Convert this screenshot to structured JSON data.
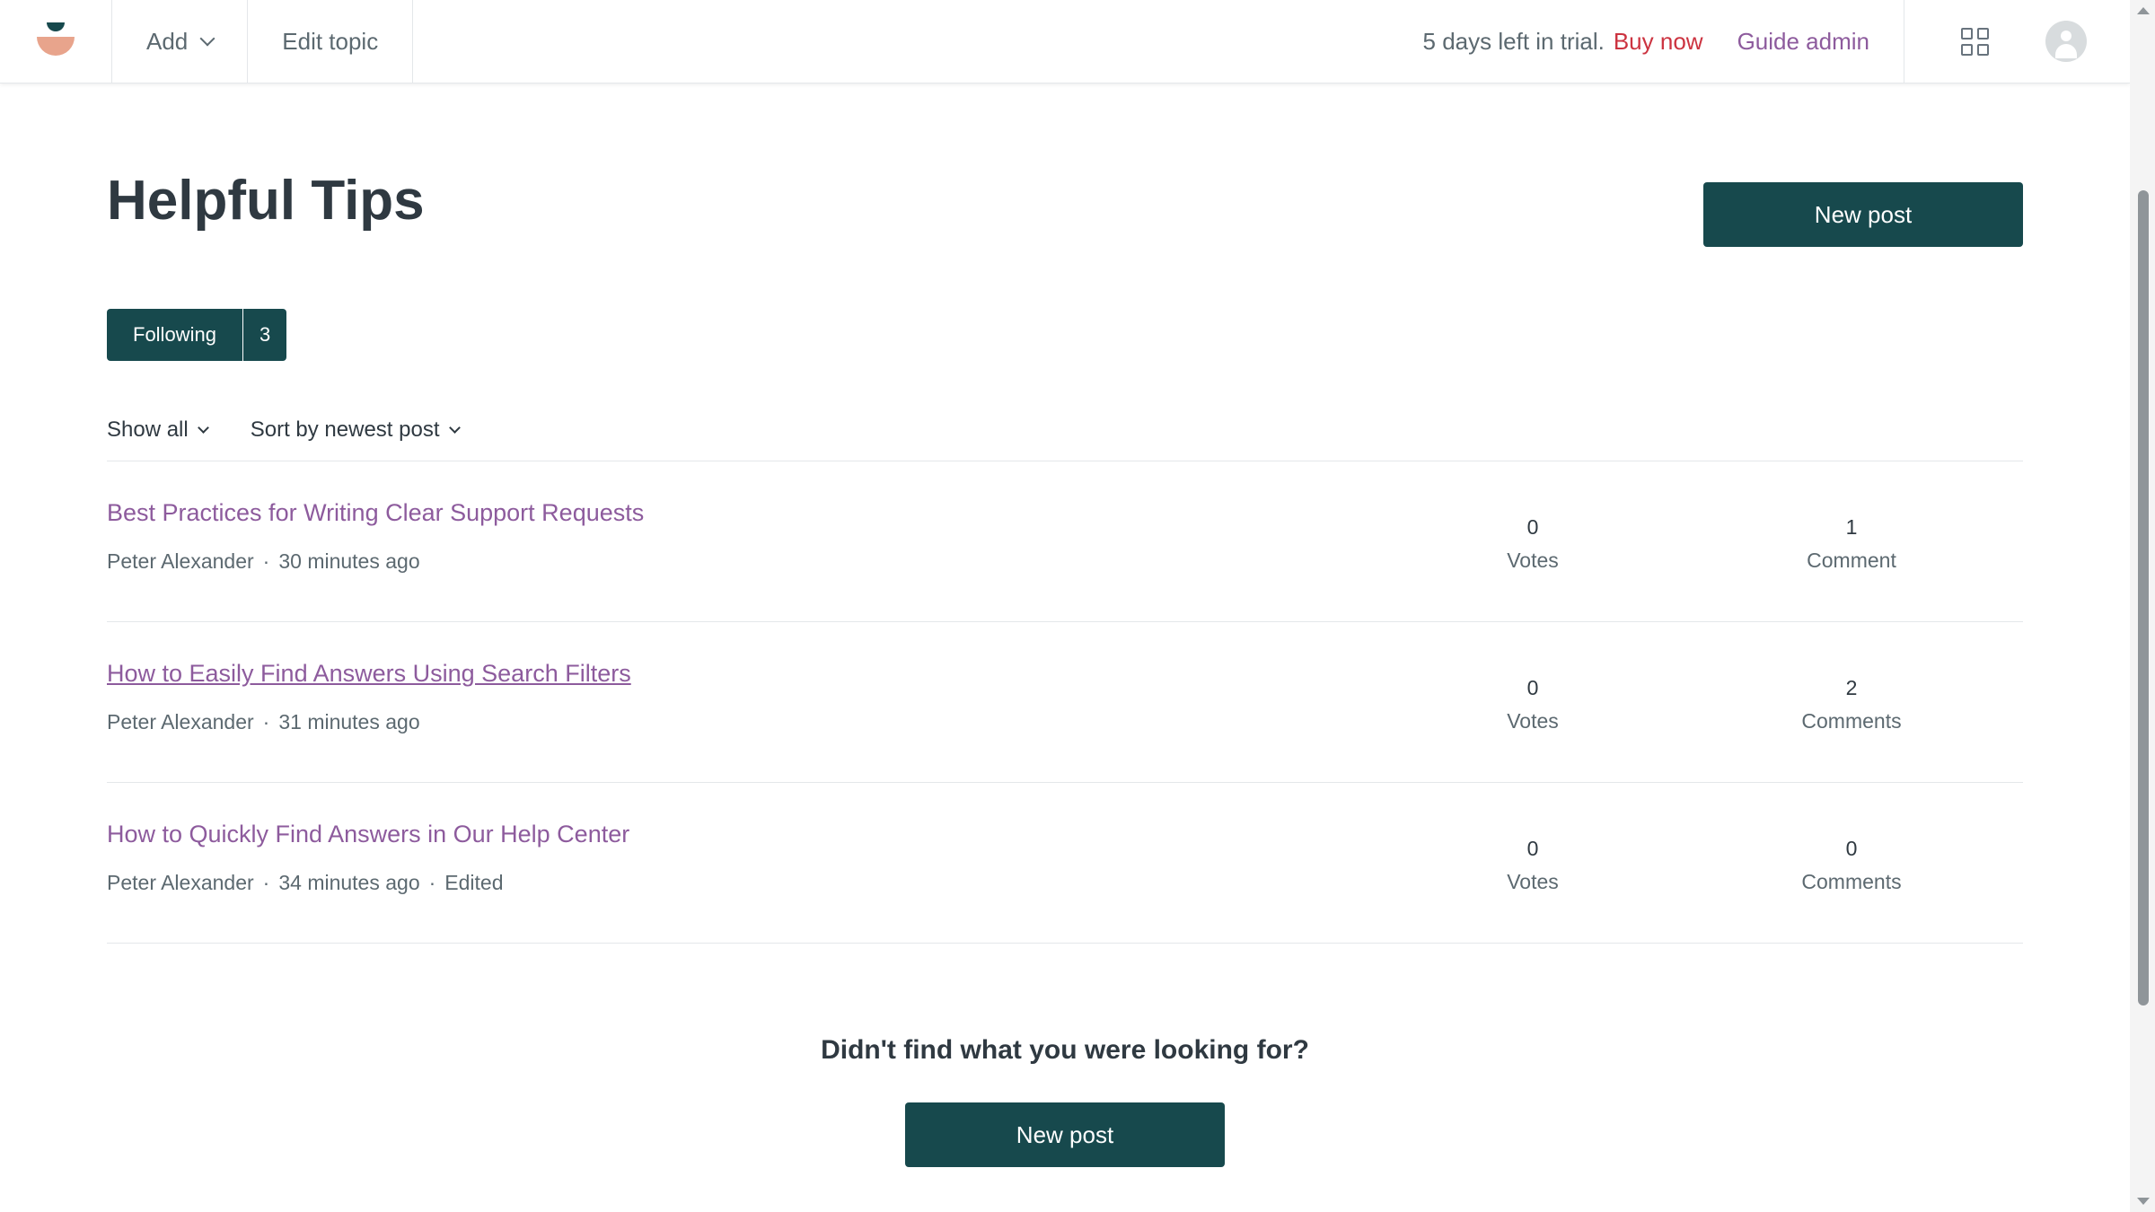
{
  "header": {
    "add_label": "Add",
    "edit_topic_label": "Edit topic",
    "trial_text": "5 days left in trial.",
    "buy_now_label": "Buy now",
    "guide_admin_label": "Guide admin"
  },
  "page": {
    "title": "Helpful Tips",
    "new_post_label": "New post",
    "following_label": "Following",
    "following_count": "3",
    "filter_show_label": "Show all",
    "filter_sort_label": "Sort by newest post"
  },
  "posts": [
    {
      "title": "Best Practices for Writing Clear Support Requests",
      "author": "Peter Alexander",
      "time": "30 minutes ago",
      "edited": "",
      "votes": "0",
      "votes_label": "Votes",
      "comments": "1",
      "comments_label": "Comment"
    },
    {
      "title": "How to Easily Find Answers Using Search Filters",
      "author": "Peter Alexander",
      "time": "31 minutes ago",
      "edited": "",
      "votes": "0",
      "votes_label": "Votes",
      "comments": "2",
      "comments_label": "Comments"
    },
    {
      "title": "How to Quickly Find Answers in Our Help Center",
      "author": "Peter Alexander",
      "time": "34 minutes ago",
      "edited": "Edited",
      "votes": "0",
      "votes_label": "Votes",
      "comments": "0",
      "comments_label": "Comments"
    }
  ],
  "footer": {
    "cta_text": "Didn't find what you were looking for?",
    "new_post_label": "New post"
  },
  "colors": {
    "primary": "#17494d",
    "link": "#8d5b9d",
    "buy_now": "#cc3340",
    "logo_accent": "#e8a48c"
  }
}
